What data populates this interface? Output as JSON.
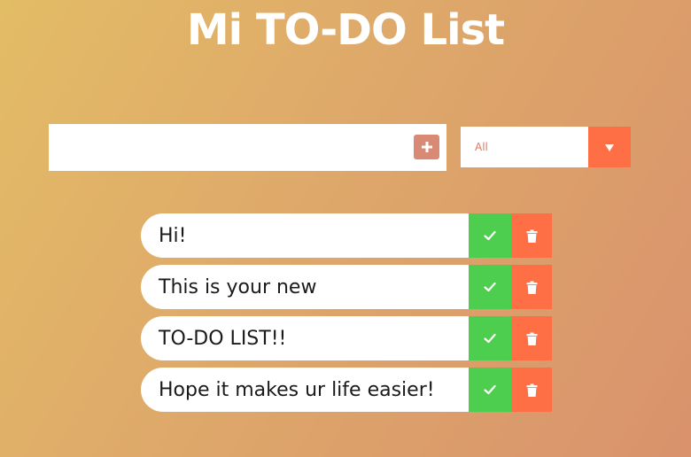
{
  "app": {
    "title": "Mi TO-DO List"
  },
  "input": {
    "value": "",
    "placeholder": "",
    "add_icon": "plus-square-icon"
  },
  "filter": {
    "selected": "All",
    "arrow_icon": "triangle-down-icon"
  },
  "todos": [
    {
      "text": "Hi!"
    },
    {
      "text": "This is your new"
    },
    {
      "text": "TO-DO LIST!!"
    },
    {
      "text": "Hope it makes ur life easier!"
    }
  ],
  "actions": {
    "complete_icon": "check-icon",
    "delete_icon": "trash-icon"
  },
  "colors": {
    "gradient_start": "#e3bc66",
    "gradient_end": "#d9926c",
    "complete": "#4ece4e",
    "delete": "#ff6f45",
    "add_button": "#d98a75"
  }
}
